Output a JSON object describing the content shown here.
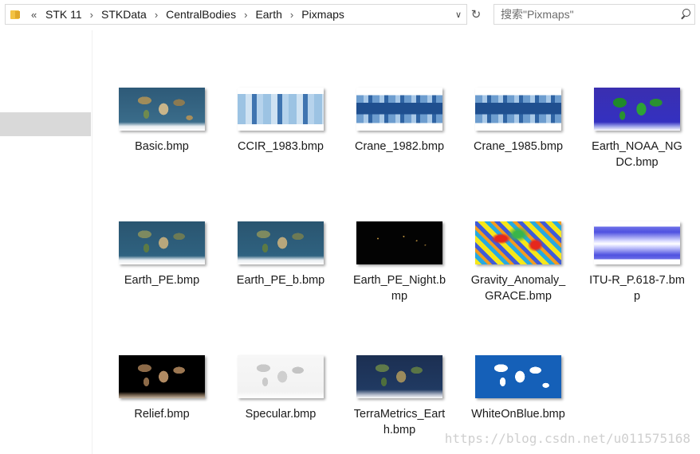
{
  "address_bar": {
    "overflow": "«",
    "crumbs": [
      "STK 11",
      "STKData",
      "CentralBodies",
      "Earth",
      "Pixmaps"
    ],
    "separator": "›",
    "dropdown": "∨",
    "refresh": "↻"
  },
  "search": {
    "placeholder": "搜索\"Pixmaps\""
  },
  "files": [
    {
      "name": "Basic.bmp",
      "thumb": "earth-color"
    },
    {
      "name": "CCIR_1983.bmp",
      "thumb": "blue-bands"
    },
    {
      "name": "Crane_1982.bmp",
      "thumb": "blue-bands"
    },
    {
      "name": "Crane_1985.bmp",
      "thumb": "blue-bands"
    },
    {
      "name": "Earth_NOAA_NGDC.bmp",
      "thumb": "earth-noaa"
    },
    {
      "name": "Earth_PE.bmp",
      "thumb": "earth-color"
    },
    {
      "name": "Earth_PE_b.bmp",
      "thumb": "earth-color"
    },
    {
      "name": "Earth_PE_Night.bmp",
      "thumb": "earth-night"
    },
    {
      "name": "Gravity_Anomaly_GRACE.bmp",
      "thumb": "gravity-map"
    },
    {
      "name": "ITU-R_P.618-7.bmp",
      "thumb": "itu-map"
    },
    {
      "name": "Relief.bmp",
      "thumb": "relief-map"
    },
    {
      "name": "Specular.bmp",
      "thumb": "specular-map"
    },
    {
      "name": "TerraMetrics_Earth.bmp",
      "thumb": "terra-map"
    },
    {
      "name": "WhiteOnBlue.bmp",
      "thumb": "white-on-blue-map"
    }
  ],
  "watermark": "https://blog.csdn.net/u011575168"
}
